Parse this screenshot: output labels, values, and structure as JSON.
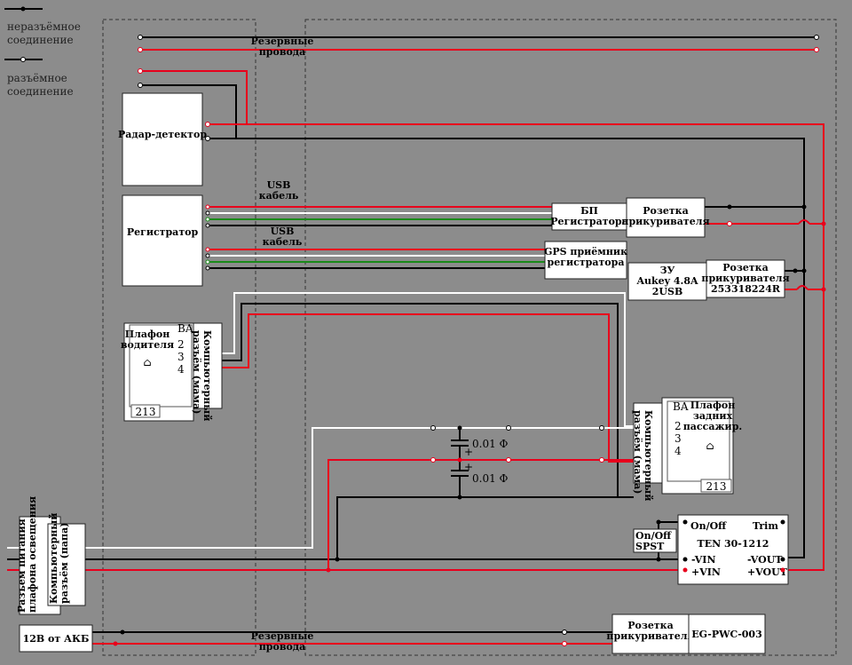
{
  "legend": {
    "permanent": "неразъёмное соединение",
    "detachable": "разъёмное соединение"
  },
  "labels": {
    "spare_wires_top": "Резервные провода",
    "spare_wires_bottom": "Резервные провода",
    "usb_cable_1": "USB кабель",
    "usb_cable_2": "USB кабель",
    "cap_1": "0.01 Ф",
    "cap_2": "0.01 Ф",
    "plus_1": "+",
    "plus_2": "+"
  },
  "blocks": {
    "radar": "Радар-детектор",
    "registrator": "Регистратор",
    "psu_registrator": "БП Регистратора",
    "lighter_socket_1": "Розетка прикуривателя",
    "gps": "GPS приёмник регистратора",
    "charger": "ЗУ Aukey 4.8A 2USB",
    "lighter_socket_2": "Розетка прикуривателя 253318224R",
    "driver_lamp": "Плафон водителя",
    "driver_connector": "Компьютерный разъём (мама)",
    "driver_lamp_code": "213",
    "driver_pins": [
      "BA",
      "2",
      "3",
      "4"
    ],
    "rear_lamp": "Плафон задних пассажир.",
    "rear_connector": "Компьютерный разъём (мама)",
    "rear_lamp_code": "213",
    "rear_pins": [
      "BA",
      "2",
      "3",
      "4"
    ],
    "ten_on_off": "On/Off",
    "ten_trim": "Trim",
    "ten_model": "TEN 30-1212",
    "ten_vin_minus": "-VIN",
    "ten_vin_plus": "+VIN",
    "ten_vout_minus": "-VOUT",
    "ten_vout_plus": "+VOUT",
    "spst": "On/Off SPST",
    "power_connector": "Разъем питания плафона освещения",
    "power_connector_papa": "Компьютерный разъём (папа)",
    "battery": "12В от АКБ",
    "lighter_socket_3": "Розетка прикуривателя",
    "egpwc": "EG-PWC-003"
  },
  "colors": {
    "background": "#8c8c8c",
    "red_wire": "#e8001c",
    "black_wire": "#000000",
    "white_wire": "#ffffff",
    "green_wire": "#1a8a1a"
  }
}
